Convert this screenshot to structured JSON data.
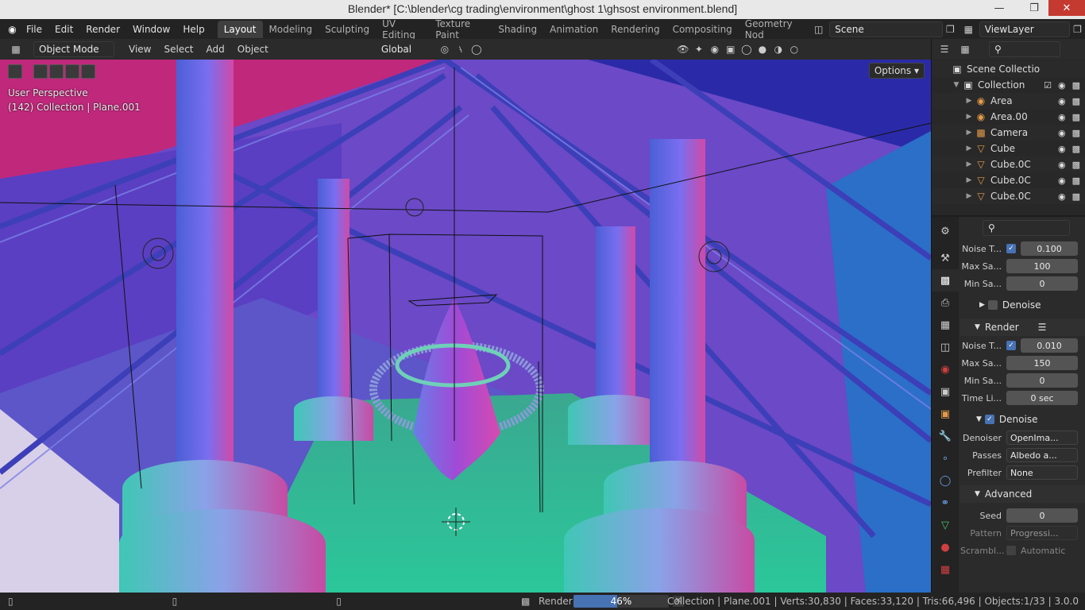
{
  "window": {
    "title": "Blender* [C:\\blender\\cg trading\\environment\\ghost 1\\ghsost environment.blend]"
  },
  "menu": {
    "items": [
      "File",
      "Edit",
      "Render",
      "Window",
      "Help"
    ]
  },
  "workspaces": [
    "Layout",
    "Modeling",
    "Sculpting",
    "UV Editing",
    "Texture Paint",
    "Shading",
    "Animation",
    "Rendering",
    "Compositing",
    "Geometry Nod"
  ],
  "scene": {
    "name": "Scene",
    "view_layer": "ViewLayer"
  },
  "viewport_header": {
    "mode": "Object Mode",
    "view": "View",
    "select": "Select",
    "add": "Add",
    "object": "Object",
    "transform": "Global"
  },
  "viewport": {
    "perspective": "User Perspective",
    "context": "(142) Collection | Plane.001",
    "options": "Options"
  },
  "outliner": {
    "root": "Scene Collectio",
    "collection": "Collection",
    "items": [
      {
        "name": "Area",
        "icon": "light-icon"
      },
      {
        "name": "Area.00",
        "icon": "light-icon"
      },
      {
        "name": "Camera",
        "icon": "camera-icon"
      },
      {
        "name": "Cube",
        "icon": "mesh-icon"
      },
      {
        "name": "Cube.0C",
        "icon": "mesh-icon"
      },
      {
        "name": "Cube.0C",
        "icon": "mesh-icon"
      },
      {
        "name": "Cube.0C",
        "icon": "mesh-icon"
      },
      {
        "name": "Cube.0C",
        "icon": "mesh-icon"
      }
    ]
  },
  "properties": {
    "viewport": {
      "noise_label": "Noise T...",
      "noise": "0.100",
      "max_label": "Max Sa...",
      "max": "100",
      "min_label": "Min Sa...",
      "min": "0"
    },
    "denoise_collapsed": "Denoise",
    "render_section": "Render",
    "render": {
      "noise_label": "Noise T...",
      "noise": "0.010",
      "max_label": "Max Sa...",
      "max": "150",
      "min_label": "Min Sa...",
      "min": "0",
      "time_label": "Time Li...",
      "time": "0 sec"
    },
    "denoise_section": "Denoise",
    "denoiser_label": "Denoiser",
    "denoiser": "OpenIma...",
    "passes_label": "Passes",
    "passes": "Albedo a...",
    "prefilter_label": "Prefilter",
    "prefilter": "None",
    "advanced_section": "Advanced",
    "seed_label": "Seed",
    "seed": "0",
    "pattern_label": "Pattern",
    "pattern": "Progressi...",
    "scrambling_label": "Scrambl...",
    "automatic": "Automatic"
  },
  "status": {
    "job": "Render",
    "progress": 46,
    "progress_text": "46%",
    "stats": "Collection | Plane.001 | Verts:30,830 | Faces:33,120 | Tris:66,496 | Objects:1/33 | 3.0.0"
  },
  "colors": {
    "accent": "#4772b3",
    "viewport_bg": "#6b49c7"
  }
}
